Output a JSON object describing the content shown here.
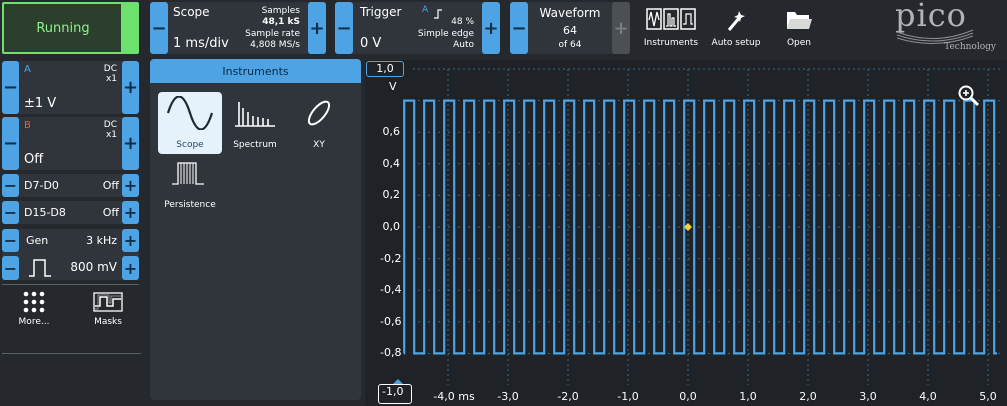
{
  "run_button": {
    "label": "Running"
  },
  "scope": {
    "title": "Scope",
    "timebase": "1 ms/div",
    "samples_label": "Samples",
    "samples_value": "48,1 kS",
    "rate_label": "Sample rate",
    "rate_value": "4,808 MS/s"
  },
  "trigger": {
    "title": "Trigger",
    "level": "0 V",
    "channel": "A",
    "percent": "48 %",
    "type": "Simple edge",
    "mode": "Auto"
  },
  "waveform": {
    "title": "Waveform",
    "current": "64",
    "of": "of 64"
  },
  "toolbar": {
    "instruments": "Instruments",
    "autosetup": "Auto setup",
    "open": "Open"
  },
  "logo": {
    "text": "pico",
    "sub": "Technology"
  },
  "channel_a": {
    "name": "A",
    "coupling": "DC",
    "probe": "x1",
    "range": "±1 V",
    "color": "#4da3e3"
  },
  "channel_b": {
    "name": "B",
    "coupling": "DC",
    "probe": "x1",
    "range": "Off",
    "color": "#e06040"
  },
  "digital": [
    {
      "name": "D7-D0",
      "state": "Off"
    },
    {
      "name": "D15-D8",
      "state": "Off"
    }
  ],
  "generator": {
    "label": "Gen",
    "freq": "3 kHz",
    "ampl": "800 mV"
  },
  "bottom_tools": {
    "more": "More...",
    "masks": "Masks"
  },
  "instruments_panel": {
    "title": "Instruments",
    "items": [
      "Scope",
      "Spectrum",
      "XY",
      "Persistence"
    ]
  },
  "plot": {
    "unit": "V",
    "y_top_label": "1,0",
    "y_bottom_label": "-1,0",
    "y_ticks": [
      "0,6",
      "0,4",
      "0,2",
      "0,0",
      "-0,2",
      "-0,4",
      "-0,6",
      "-0,8"
    ],
    "x_ticks": [
      "-4,0 ms",
      "-3,0",
      "-2,0",
      "-1,0",
      "0,0",
      "1,0",
      "2,0",
      "3,0",
      "4,0",
      "5,0"
    ]
  },
  "chart_data": {
    "type": "line",
    "title": "",
    "xlabel": "",
    "ylabel": "V",
    "xlim": [
      -5.0,
      5.0
    ],
    "ylim": [
      -1.0,
      1.0
    ],
    "grid": true,
    "series": [
      {
        "name": "A",
        "shape": "square",
        "frequency_khz": 3,
        "high": 0.8,
        "low": -0.8,
        "color": "#4da3e3"
      }
    ]
  }
}
